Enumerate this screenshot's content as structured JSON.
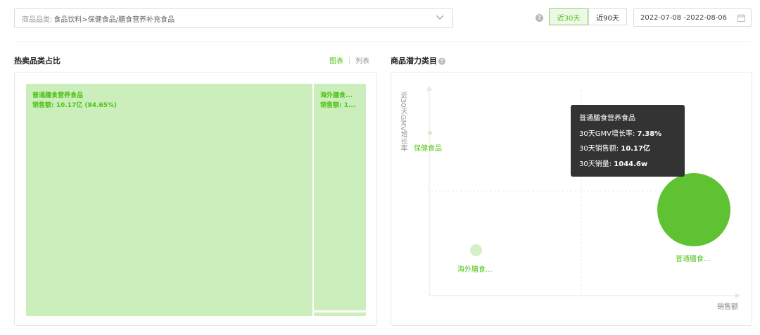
{
  "filter": {
    "category_prefix": "商品品类:",
    "category_value": "食品饮料>保健食品/膳食营养补充食品"
  },
  "date_range": {
    "options": [
      "近30天",
      "近90天"
    ],
    "active": "近30天",
    "value": "2022-07-08 -2022-08-06"
  },
  "hot_category": {
    "title": "热卖品类占比",
    "view_chart": "图表",
    "view_list": "列表",
    "blocks": [
      {
        "name": "普通膳食营养食品",
        "sales_label": "销售额: 10.17亿 (84.65%)",
        "sales_value": 10.17,
        "share_pct": 84.65
      },
      {
        "name": "海外膳食...",
        "sales_label": "销售额: 1..."
      }
    ]
  },
  "potential": {
    "title": "商品潜力类目",
    "help": "?",
    "y_axis_label": "近30天GMV增长率",
    "x_axis_label": "销售额",
    "points": [
      {
        "name": "保健食品"
      },
      {
        "name": "海外膳食..."
      },
      {
        "name": "普通膳食..."
      }
    ],
    "tooltip": {
      "title": "普通膳食营养食品",
      "rows": [
        {
          "label": "30天GMV增长率: ",
          "value": "7.38%"
        },
        {
          "label": "30天销售额: ",
          "value": "10.17亿"
        },
        {
          "label": "30天销量: ",
          "value": "1044.6w"
        }
      ]
    }
  },
  "colors": {
    "accent": "#52c41a",
    "treemap_fill": "#cbeebc",
    "bubble_main": "#5ec232",
    "bubble_small": "#d4f0c6"
  }
}
